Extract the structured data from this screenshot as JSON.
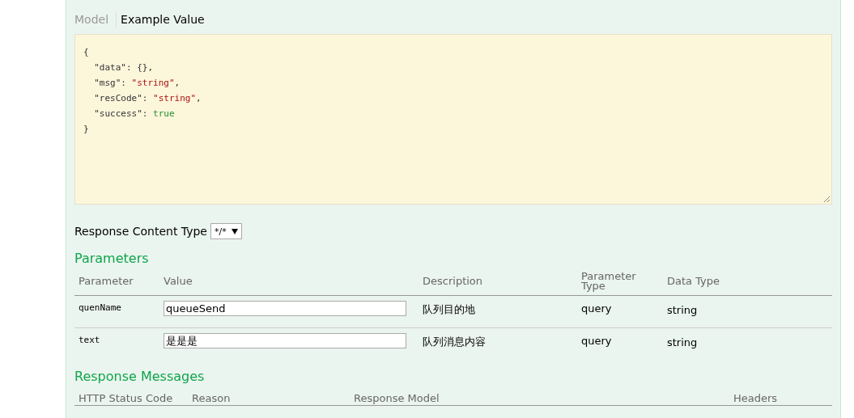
{
  "model_tabs": [
    {
      "label": "Model",
      "selected": false
    },
    {
      "label": "Example Value",
      "selected": true
    }
  ],
  "example_value": [
    {
      "tokens": [
        {
          "text": "{",
          "kind": "punct"
        }
      ]
    },
    {
      "tokens": [
        {
          "text": "  \"data\"",
          "kind": "key"
        },
        {
          "text": ": {},",
          "kind": "punct"
        }
      ]
    },
    {
      "tokens": [
        {
          "text": "  \"msg\"",
          "kind": "key"
        },
        {
          "text": ": ",
          "kind": "punct"
        },
        {
          "text": "\"string\"",
          "kind": "string"
        },
        {
          "text": ",",
          "kind": "punct"
        }
      ]
    },
    {
      "tokens": [
        {
          "text": "  \"resCode\"",
          "kind": "key"
        },
        {
          "text": ": ",
          "kind": "punct"
        },
        {
          "text": "\"string\"",
          "kind": "string"
        },
        {
          "text": ",",
          "kind": "punct"
        }
      ]
    },
    {
      "tokens": [
        {
          "text": "  \"success\"",
          "kind": "key"
        },
        {
          "text": ": ",
          "kind": "punct"
        },
        {
          "text": "true",
          "kind": "boolean"
        }
      ]
    },
    {
      "tokens": [
        {
          "text": "}",
          "kind": "punct"
        }
      ]
    }
  ],
  "response_content_type": {
    "label": "Response Content Type",
    "value": "*/*"
  },
  "parameters": {
    "title": "Parameters",
    "columns": [
      "Parameter",
      "Value",
      "Description",
      "Parameter Type",
      "Data Type"
    ],
    "rows": [
      {
        "name": "quenName",
        "value": "queueSend",
        "description": "队列目的地",
        "parameter_type": "query",
        "data_type": "string"
      },
      {
        "name": "text",
        "value": "是是是",
        "description": "队列消息内容",
        "parameter_type": "query",
        "data_type": "string"
      }
    ]
  },
  "response_messages": {
    "title": "Response Messages",
    "columns": [
      "HTTP Status Code",
      "Reason",
      "Response Model",
      "Headers"
    ]
  }
}
